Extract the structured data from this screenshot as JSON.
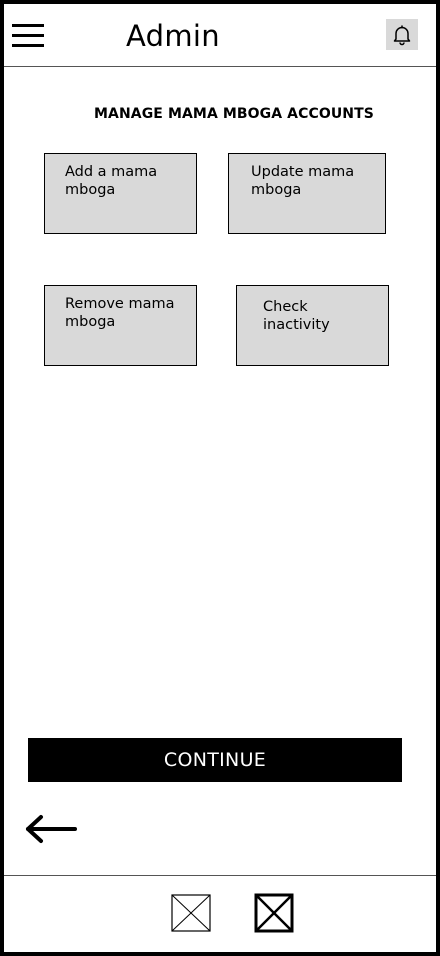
{
  "header": {
    "title": "Admin",
    "menu_icon": "hamburger-menu-icon",
    "notification_icon": "bell-icon"
  },
  "main": {
    "section_title": "MANAGE MAMA MBOGA ACCOUNTS",
    "tiles": [
      {
        "label": "Add a mama\nmboga"
      },
      {
        "label": "Update mama\nmboga"
      },
      {
        "label": "Remove mama\nmboga"
      },
      {
        "label": "Check\ninactivity"
      }
    ],
    "continue_label": "CONTINUE",
    "back_icon": "arrow-left-icon"
  },
  "footer": {
    "icons": [
      "image-placeholder-icon",
      "image-placeholder-icon"
    ]
  },
  "colors": {
    "tile_background": "#d9d9d9",
    "button_background": "#000000",
    "button_text": "#ffffff"
  }
}
